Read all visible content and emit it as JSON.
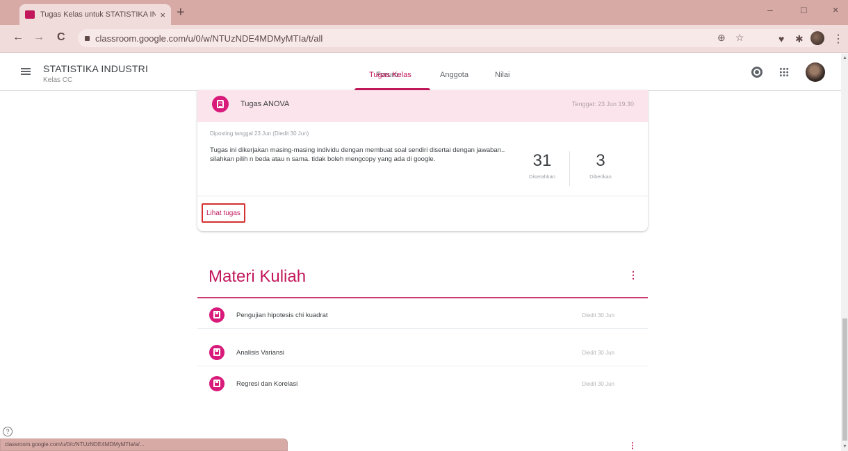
{
  "browser": {
    "tab_title": "Tugas Kelas untuk STATISTIKA IN...",
    "tab_close": "×",
    "new_tab": "+",
    "url": "classroom.google.com/u/0/w/NTUzNDE4MDMyMTIa/t/all",
    "win_minimize": "–",
    "win_restore": "□",
    "win_close": "×",
    "nav_back": "←",
    "nav_forward": "→",
    "nav_reload": "C",
    "zoom_icon": "⊕",
    "star_icon": "☆",
    "menu_icon": "⋮"
  },
  "classroom": {
    "class_name": "STATISTIKA INDUSTRI",
    "class_section": "Kelas CC",
    "tabs": [
      {
        "label": "Forum",
        "active": false
      },
      {
        "label": "Tugas Kelas",
        "active": true
      },
      {
        "label": "Anggota",
        "active": false
      },
      {
        "label": "Nilai",
        "active": false
      }
    ],
    "accent_color": "#c2185b"
  },
  "assignment": {
    "title": "Tugas ANOVA",
    "due": "Tenggat: 23 Jun 19.30",
    "posted": "Diposting tanggal 23 Jun (Diedit 30 Jun)",
    "description": "Tugas ini dikerjakan masing-masing individu dengan membuat soal sendiri disertai dengan jawaban.. silahkan pilih n beda atau n sama. tidak boleh mengcopy yang ada di google.",
    "stats": [
      {
        "value": "31",
        "label": "Diserahkan"
      },
      {
        "value": "3",
        "label": "Diberikan"
      }
    ],
    "view_button": "Lihat tugas"
  },
  "materials": {
    "title": "Materi Kuliah",
    "more_icon": "⋮",
    "items": [
      {
        "title": "Pengujian hipotesis chi kuadrat",
        "date": "Diedit 30 Jun"
      },
      {
        "title": "Analisis Variansi",
        "date": "Diedit 30 Jun"
      },
      {
        "title": "Regresi dan Korelasi",
        "date": "Diedit 30 Jun"
      }
    ]
  },
  "footer": {
    "help": "?",
    "status_url": "classroom.google.com/u/0/c/NTUzNDE4MDMyMTIa/a/...",
    "more_icon": "⋮"
  }
}
